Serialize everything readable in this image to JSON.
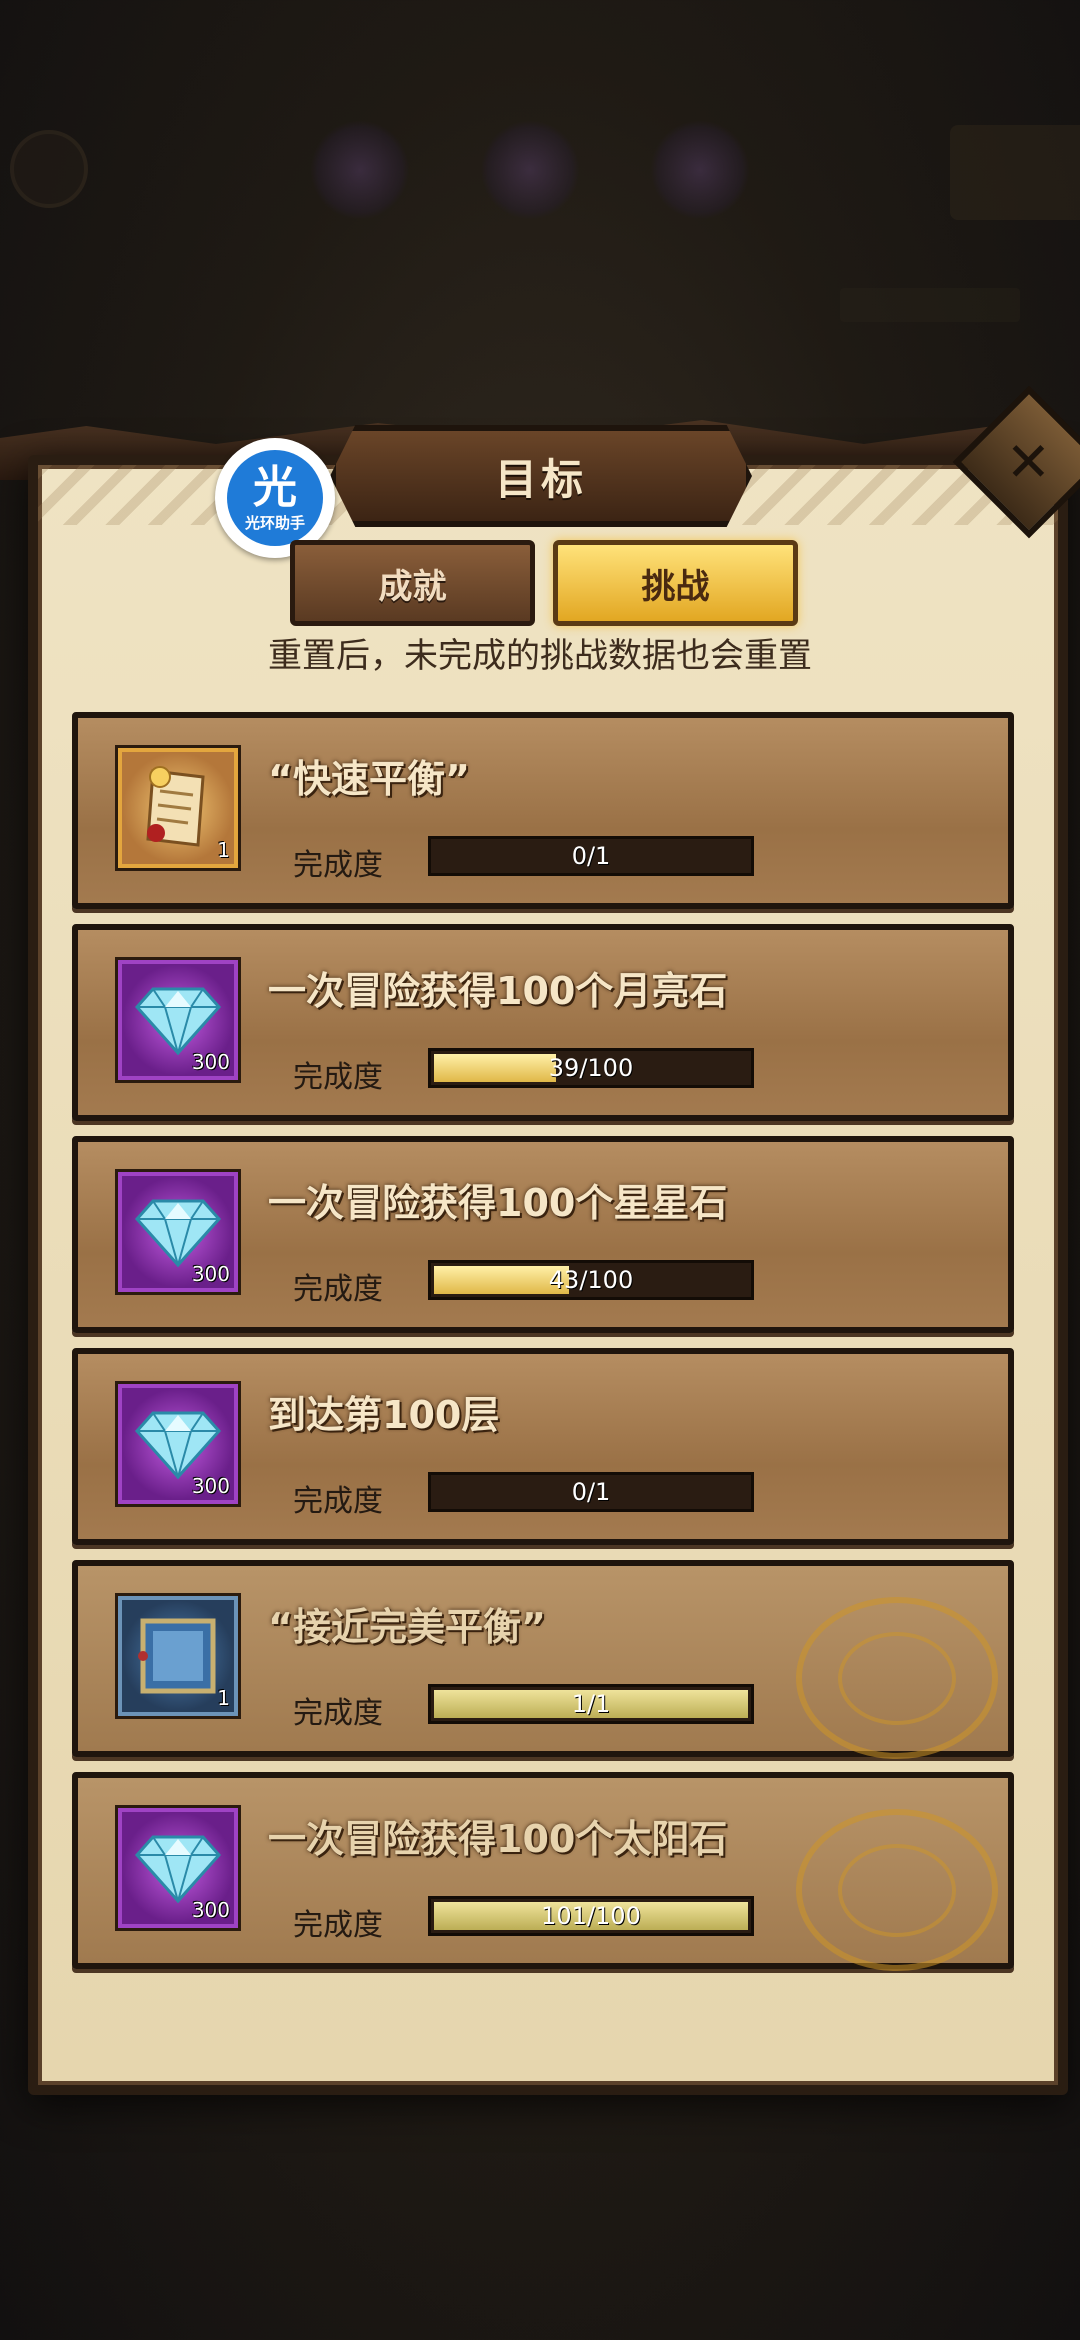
{
  "panel": {
    "title": "目标",
    "close_symbol": "✕",
    "watermark": {
      "line1": "光",
      "line2": "光环助手"
    },
    "tabs": [
      {
        "label": "成就",
        "active": false
      },
      {
        "label": "挑战",
        "active": true
      }
    ],
    "subtitle": "重置后，未完成的挑战数据也会重置",
    "progress_label": "完成度"
  },
  "cards": [
    {
      "title": "“快速平衡”",
      "icon": "scroll-icon",
      "quantity": "1",
      "progress_text": "0/1",
      "progress": 0.0,
      "completed": false
    },
    {
      "title": "一次冒险获得100个月亮石",
      "icon": "diamond-icon",
      "quantity": "300",
      "progress_text": "39/100",
      "progress": 0.39,
      "completed": false
    },
    {
      "title": "一次冒险获得100个星星石",
      "icon": "diamond-icon",
      "quantity": "300",
      "progress_text": "43/100",
      "progress": 0.43,
      "completed": false
    },
    {
      "title": "到达第100层",
      "icon": "diamond-icon",
      "quantity": "300",
      "progress_text": "0/1",
      "progress": 0.0,
      "completed": false
    },
    {
      "title": "“接近完美平衡”",
      "icon": "frame-icon",
      "quantity": "1",
      "progress_text": "1/1",
      "progress": 1.0,
      "completed": true
    },
    {
      "title": "一次冒险获得100个太阳石",
      "icon": "diamond-icon",
      "quantity": "300",
      "progress_text": "101/100",
      "progress": 1.0,
      "completed": true
    }
  ],
  "colors": {
    "accent_gold": "#e2a722",
    "panel_bg": "#efe3c3",
    "card_bg": "#a37a4f"
  }
}
